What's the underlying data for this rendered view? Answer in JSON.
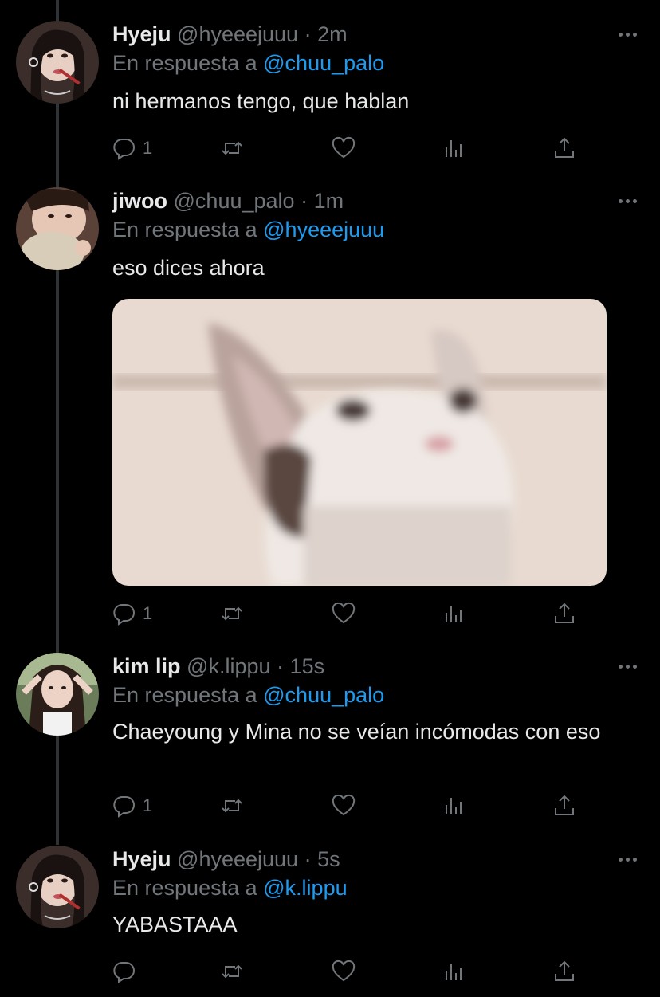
{
  "tweets": [
    {
      "name": "Hyeju",
      "handle": "@hyeeejuuu",
      "time": "2m",
      "reply_prefix": "En respuesta a",
      "reply_to": "@chuu_palo",
      "text": "ni hermanos tengo, que hablan",
      "reply_count": "1"
    },
    {
      "name": "jiwoo",
      "handle": "@chuu_palo",
      "time": "1m",
      "reply_prefix": "En respuesta a",
      "reply_to": "@hyeeejuuu",
      "text": "eso dices ahora",
      "reply_count": "1"
    },
    {
      "name": "kim lip",
      "handle": "@k.lippu",
      "time": "15s",
      "reply_prefix": "En respuesta a",
      "reply_to": "@chuu_palo",
      "text": "Chaeyoung y Mina no se veían incómodas con eso",
      "reply_count": "1"
    },
    {
      "name": "Hyeju",
      "handle": "@hyeeejuuu",
      "time": "5s",
      "reply_prefix": "En respuesta a",
      "reply_to": "@k.lippu",
      "text": "YABASTAAA",
      "reply_count": ""
    }
  ],
  "separator": "·",
  "icons": {
    "reply": "reply-icon",
    "retweet": "retweet-icon",
    "like": "heart-icon",
    "views": "views-icon",
    "share": "share-icon",
    "more": "more-icon"
  },
  "colors": {
    "background": "#000000",
    "text": "#e7e9ea",
    "muted": "#71767b",
    "accent": "#1d9bf0"
  }
}
